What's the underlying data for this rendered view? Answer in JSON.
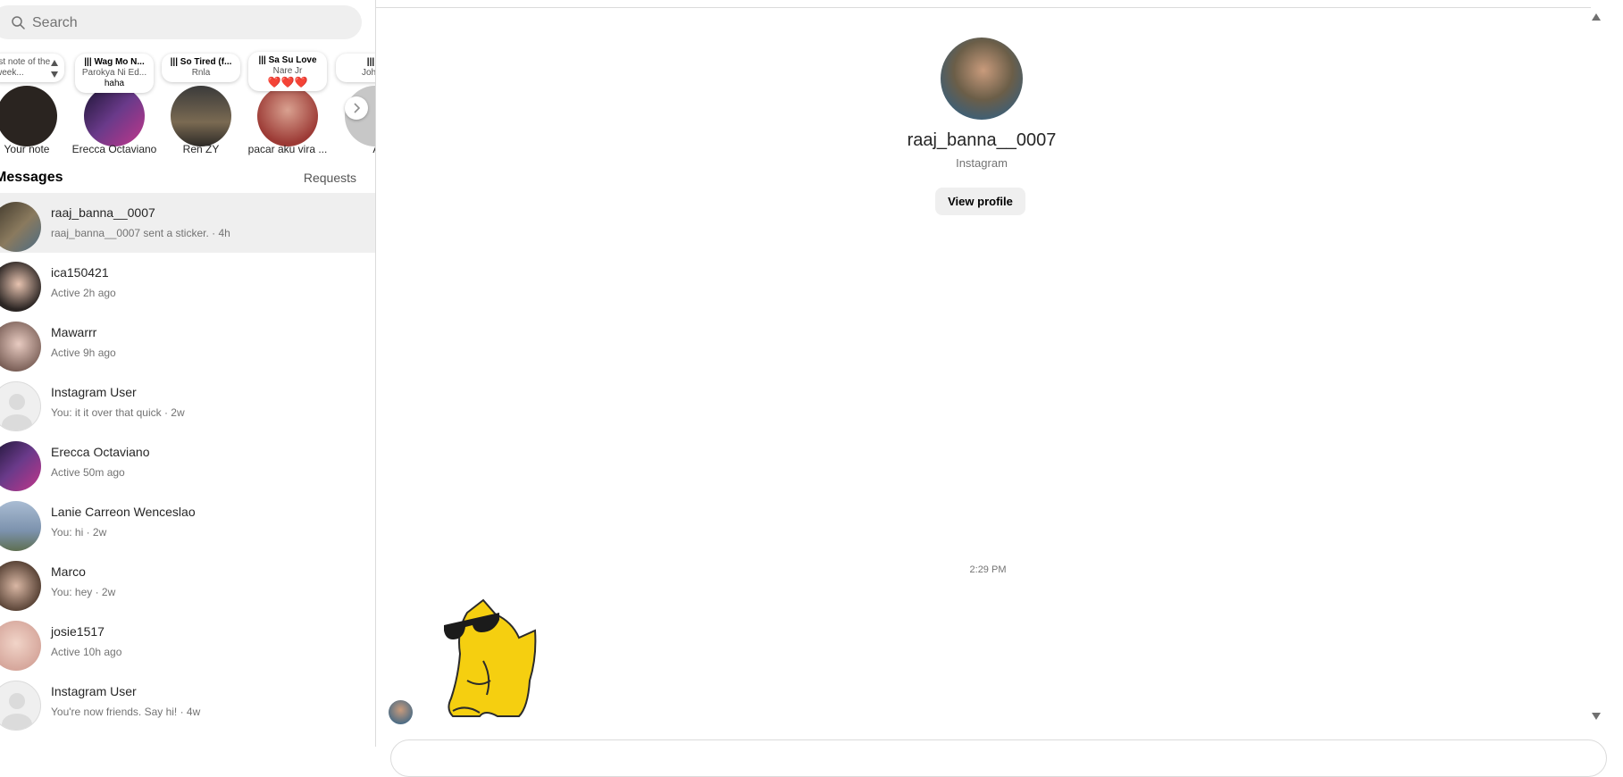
{
  "search": {
    "placeholder": "Search",
    "icon": "search-icon"
  },
  "notes": [
    {
      "text": "rst note of the week...",
      "artist": "",
      "extra": "",
      "name": "Your note",
      "avatar_color": "#2a2420",
      "music": false
    },
    {
      "text": "Wag Mo N...",
      "artist": "Parokya Ni Ed...",
      "extra": "haha",
      "name": "Erecca Octaviano",
      "avatar_color": "#3b2a5c",
      "music": true
    },
    {
      "text": "So Tired (f...",
      "artist": "Rnla",
      "extra": "",
      "name": "Ren ZY",
      "avatar_color": "#5a4f3c",
      "music": true
    },
    {
      "text": "Sa Su Love",
      "artist": "Nare Jr",
      "extra": "❤️❤️❤️",
      "name": "pacar aku vira ...",
      "avatar_color": "#9c3a35",
      "music": true
    },
    {
      "text": "H",
      "artist": "John L",
      "extra": "",
      "name": "Abi",
      "avatar_color": "#c7c7c7",
      "music": true
    }
  ],
  "messages_header": {
    "title": "Messages",
    "requests": "Requests"
  },
  "conversations": [
    {
      "name": "raaj_banna__0007",
      "sub": "raaj_banna__0007 sent a sticker. · 4h",
      "active": true,
      "avatar_color": "#6b5e48"
    },
    {
      "name": "ica150421",
      "sub": "Active 2h ago",
      "active": false,
      "avatar_color": "#2b2523"
    },
    {
      "name": "Mawarrr",
      "sub": "Active 9h ago",
      "active": false,
      "avatar_color": "#b8a59e"
    },
    {
      "name": "Instagram User",
      "sub": "You: it it over that quick · 2w",
      "active": false,
      "avatar_color": "#dbdbdb"
    },
    {
      "name": "Erecca Octaviano",
      "sub": "Active 50m ago",
      "active": false,
      "avatar_color": "#3b2a5c"
    },
    {
      "name": "Lanie Carreon Wenceslao",
      "sub": "You: hi · 2w",
      "active": false,
      "avatar_color": "#7c92ad"
    },
    {
      "name": "Marco",
      "sub": "You: hey · 2w",
      "active": false,
      "avatar_color": "#8b6f5b"
    },
    {
      "name": "josie1517",
      "sub": "Active 10h ago",
      "active": false,
      "avatar_color": "#d6a79c"
    },
    {
      "name": "Instagram User",
      "sub": "You're now friends. Say hi! · 4w",
      "active": false,
      "avatar_color": "#dbdbdb"
    }
  ],
  "profile": {
    "username": "raaj_banna__0007",
    "subtitle": "Instagram",
    "view_profile": "View profile"
  },
  "chat": {
    "timestamp": "2:29 PM",
    "sticker": "yellow-cat-sunglasses-sticker"
  }
}
